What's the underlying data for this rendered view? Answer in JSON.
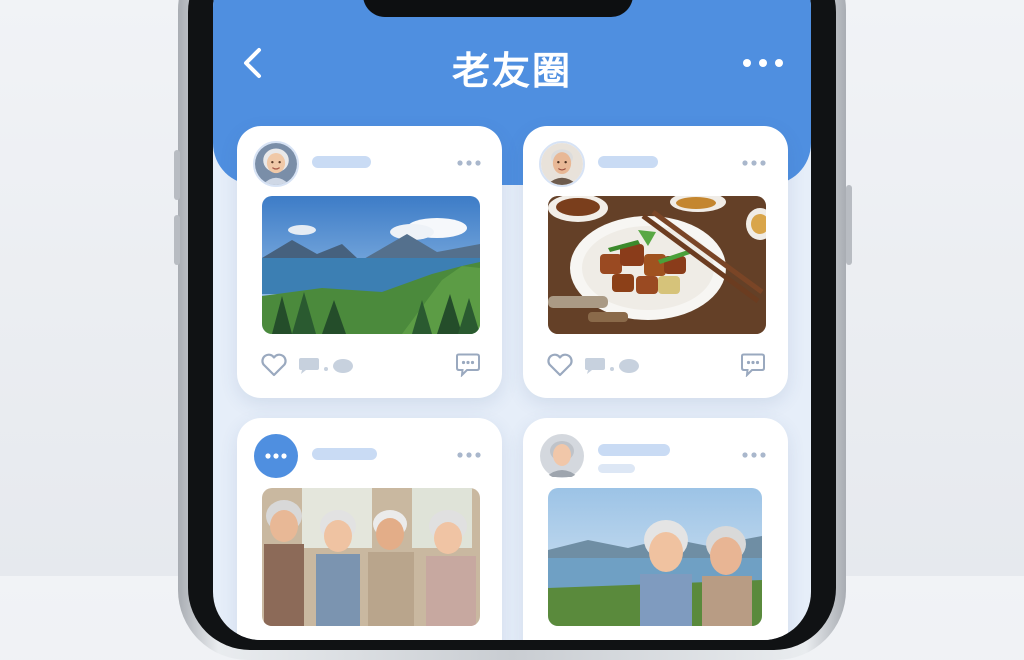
{
  "header": {
    "title": "老友圈"
  },
  "icons": {
    "back": "chevron-left-icon",
    "more": "more-horizontal-icon",
    "like": "heart-icon",
    "comment": "speech-bubble-icon",
    "message": "message-dots-icon"
  },
  "colors": {
    "header_blue": "#4f8fe0",
    "background": "#e6eef9",
    "placeholder_bar": "#c9dbf4",
    "icon_gray": "#9aa9bf"
  },
  "feed": {
    "posts": [
      {
        "author_avatar": "elderly-woman-avatar",
        "photo": "mountain-lake-landscape-photo"
      },
      {
        "author_avatar": "elderly-man-avatar",
        "photo": "braised-pork-dish-photo"
      },
      {
        "author_avatar": "chat-bubble-avatar",
        "photo": "elderly-friends-group-photo"
      },
      {
        "author_avatar": "default-person-avatar",
        "photo": "elderly-couple-by-lake-photo"
      }
    ]
  }
}
